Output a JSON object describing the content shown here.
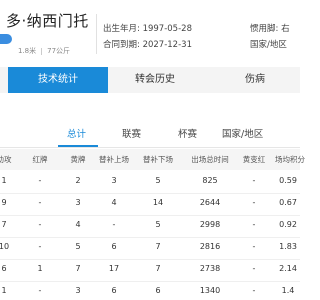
{
  "player": {
    "name": "多·纳西门托",
    "height": "1.8米",
    "weight": "77公斤",
    "birth_label": "出生年月:",
    "birth_value": "1997-05-28",
    "contract_label": "合同到期:",
    "contract_value": "2027-12-31",
    "foot_label": "惯用脚:",
    "foot_value": "右",
    "nation_label": "国家/地区"
  },
  "tabs": [
    {
      "label": "技术统计",
      "active": true
    },
    {
      "label": "转会历史",
      "active": false
    },
    {
      "label": "伤病",
      "active": false
    }
  ],
  "subtabs": [
    {
      "label": "总计",
      "active": true
    },
    {
      "label": "联赛",
      "active": false
    },
    {
      "label": "杯赛",
      "active": false
    },
    {
      "label": "国家/地区",
      "active": false
    }
  ],
  "table": {
    "columns": [
      "助攻",
      "红牌",
      "黄牌",
      "替补上场",
      "替补下场",
      "出场总时间",
      "黄变红",
      "场均积分"
    ],
    "rows": [
      [
        "1",
        "-",
        "2",
        "3",
        "5",
        "825",
        "-",
        "0.59"
      ],
      [
        "9",
        "-",
        "3",
        "4",
        "14",
        "2644",
        "-",
        "0.67"
      ],
      [
        "7",
        "-",
        "4",
        "-",
        "5",
        "2998",
        "-",
        "0.92"
      ],
      [
        "10",
        "-",
        "5",
        "6",
        "7",
        "2816",
        "-",
        "1.83"
      ],
      [
        "6",
        "1",
        "7",
        "17",
        "7",
        "2738",
        "-",
        "2.14"
      ],
      [
        "1",
        "-",
        "3",
        "6",
        "6",
        "1340",
        "-",
        "1.4"
      ]
    ]
  },
  "colors": {
    "accent": "#1a8ad8",
    "tab_bg": "#f4f4f4",
    "header_row_bg": "#f5f5f5"
  }
}
